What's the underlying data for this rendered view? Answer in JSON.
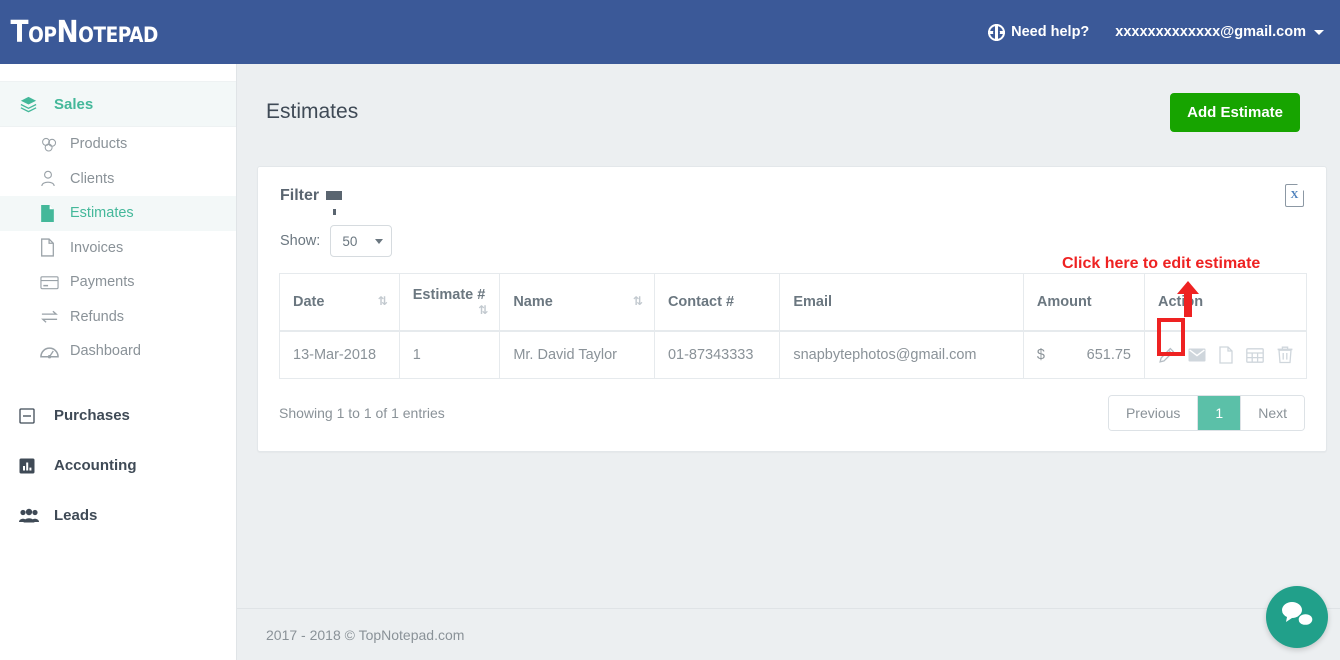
{
  "header": {
    "brand": "TopNotepad",
    "help_label": "Need help?",
    "help_icon": "life-ring-icon",
    "user_email": "xxxxxxxxxxxxx@gmail.com",
    "caret_icon": "caret-down-icon",
    "background_color": "#3b5998"
  },
  "sidebar": {
    "group": {
      "label": "Sales",
      "icon": "layers-icon",
      "active": true
    },
    "items": [
      {
        "label": "Products",
        "icon": "products-icon",
        "active": false
      },
      {
        "label": "Clients",
        "icon": "user-icon",
        "active": false
      },
      {
        "label": "Estimates",
        "icon": "file-green-icon",
        "active": true
      },
      {
        "label": "Invoices",
        "icon": "file-icon",
        "active": false
      },
      {
        "label": "Payments",
        "icon": "credit-card-icon",
        "active": false
      },
      {
        "label": "Refunds",
        "icon": "exchange-icon",
        "active": false
      },
      {
        "label": "Dashboard",
        "icon": "gauge-icon",
        "active": false
      }
    ],
    "sections": [
      {
        "label": "Purchases",
        "icon": "minus-square-icon"
      },
      {
        "label": "Accounting",
        "icon": "bar-chart-icon"
      },
      {
        "label": "Leads",
        "icon": "users-icon"
      }
    ],
    "accent_color": "#44b89a"
  },
  "main": {
    "page_title": "Estimates",
    "add_button": "Add Estimate",
    "add_button_color": "#17a400",
    "filter_label": "Filter",
    "filter_icon": "funnel-icon",
    "export_icon": "excel-export-icon",
    "export_icon_letter": "X",
    "show_label": "Show:",
    "show_value": "50",
    "columns": [
      {
        "label": "Date",
        "sortable": true
      },
      {
        "label": "Estimate #",
        "sortable": true
      },
      {
        "label": "Name",
        "sortable": true
      },
      {
        "label": "Contact #",
        "sortable": false
      },
      {
        "label": "Email",
        "sortable": false
      },
      {
        "label": "Amount",
        "sortable": false
      },
      {
        "label": "Action",
        "sortable": false
      }
    ],
    "rows": [
      {
        "date": "13-Mar-2018",
        "estimate_no": "1",
        "name": "Mr. David Taylor",
        "contact": "01-87343333",
        "email": "snapbytephotos@gmail.com",
        "currency": "$",
        "amount": "651.75",
        "actions": [
          "edit-icon",
          "email-icon",
          "pdf-icon",
          "grid-icon",
          "delete-icon"
        ]
      }
    ],
    "showing_text": "Showing 1 to 1 of 1 entries",
    "pagination": {
      "previous": "Previous",
      "pages": [
        "1"
      ],
      "next": "Next",
      "active_page": "1",
      "active_color": "#5bc0a8"
    }
  },
  "annotation": {
    "text": "Click here to edit estimate",
    "color": "#ee2222",
    "target_icon": "edit-icon"
  },
  "footer": {
    "copyright": "2017 - 2018 © TopNotepad.com"
  },
  "chat_widget": {
    "icon": "chat-bubbles-icon",
    "color": "#21a08a"
  }
}
